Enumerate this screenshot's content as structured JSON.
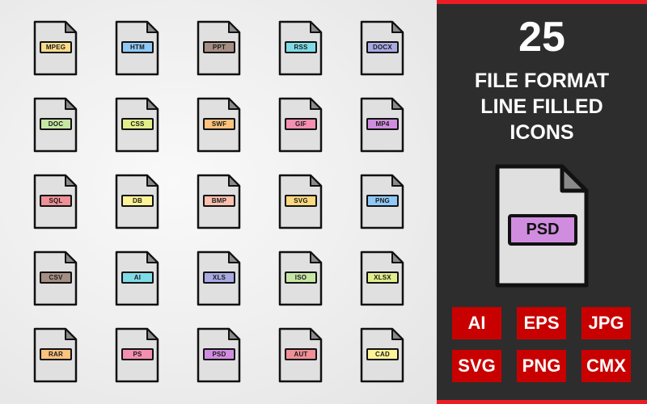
{
  "grid_icons": [
    {
      "label": "MPEG",
      "color": "#fbdc8a"
    },
    {
      "label": "HTM",
      "color": "#8fc9f7"
    },
    {
      "label": "PPT",
      "color": "#a58e84"
    },
    {
      "label": "RSS",
      "color": "#7fdbe6"
    },
    {
      "label": "DOCX",
      "color": "#a9a9e3"
    },
    {
      "label": "DOC",
      "color": "#c6e6a4"
    },
    {
      "label": "CSS",
      "color": "#e2ee8a"
    },
    {
      "label": "SWF",
      "color": "#fcc27e"
    },
    {
      "label": "GIF",
      "color": "#f48fb1"
    },
    {
      "label": "MP4",
      "color": "#d08ddf"
    },
    {
      "label": "SQL",
      "color": "#ef8f96"
    },
    {
      "label": "DB",
      "color": "#fdf397"
    },
    {
      "label": "BMP",
      "color": "#fcc0ae"
    },
    {
      "label": "SVG",
      "color": "#fcd97e"
    },
    {
      "label": "PNG",
      "color": "#8fc9f7"
    },
    {
      "label": "CSV",
      "color": "#a58e84"
    },
    {
      "label": "AI",
      "color": "#7fdbe6"
    },
    {
      "label": "XLS",
      "color": "#a9a9e3"
    },
    {
      "label": "ISO",
      "color": "#c6e6a4"
    },
    {
      "label": "XLSX",
      "color": "#e2ee8a"
    },
    {
      "label": "RAR",
      "color": "#fcc27e"
    },
    {
      "label": "PS",
      "color": "#f48fb1"
    },
    {
      "label": "PSD",
      "color": "#d08ddf"
    },
    {
      "label": "AUT",
      "color": "#ef8f96"
    },
    {
      "label": "CAD",
      "color": "#fdf397"
    }
  ],
  "panel": {
    "count": "25",
    "title_lines": [
      "FILE FORMAT",
      "LINE FILLED",
      "ICONS"
    ],
    "featured_icon": {
      "label": "PSD",
      "color": "#d08ddf"
    },
    "formats": [
      "AI",
      "EPS",
      "JPG",
      "SVG",
      "PNG",
      "CMX"
    ]
  },
  "colors": {
    "accent_red": "#ec1c24",
    "badge_red": "#c90000",
    "panel_dark": "#2d2d2d",
    "file_body": "#e0e0e0",
    "file_fold": "#8a8a8a"
  }
}
